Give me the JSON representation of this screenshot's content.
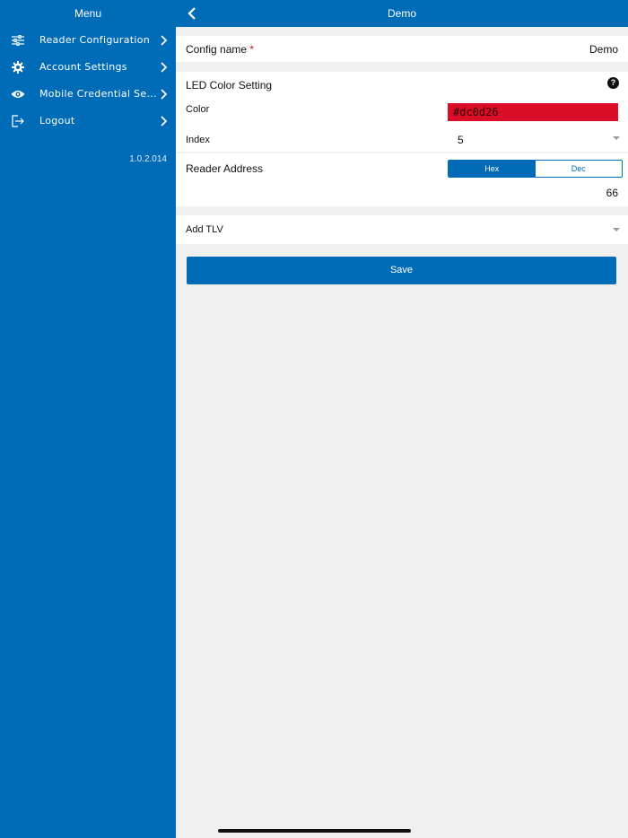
{
  "sidebar": {
    "title": "Menu",
    "items": [
      {
        "label": "Reader Configuration",
        "icon": "sliders-icon"
      },
      {
        "label": "Account Settings",
        "icon": "gear-icon"
      },
      {
        "label": "Mobile Credential Se...",
        "icon": "eye-icon"
      },
      {
        "label": "Logout",
        "icon": "logout-icon"
      }
    ],
    "version": "1.0.2.014"
  },
  "header": {
    "title": "Demo"
  },
  "form": {
    "config_name": {
      "label": "Config name",
      "required_mark": "*",
      "value": "Demo"
    },
    "led": {
      "title": "LED Color Setting",
      "help": "?",
      "color_label": "Color",
      "color_value": "#dc0d26",
      "index_label": "Index",
      "index_value": "5"
    },
    "reader_address": {
      "label": "Reader Address",
      "segments": [
        "Hex",
        "Dec"
      ],
      "selected": "Hex",
      "value": "66"
    },
    "add_tlv": {
      "label": "Add TLV"
    },
    "save_label": "Save"
  },
  "colors": {
    "brand": "#006bb7",
    "led_color": "#dc0d26",
    "background": "#f0f0f0"
  }
}
